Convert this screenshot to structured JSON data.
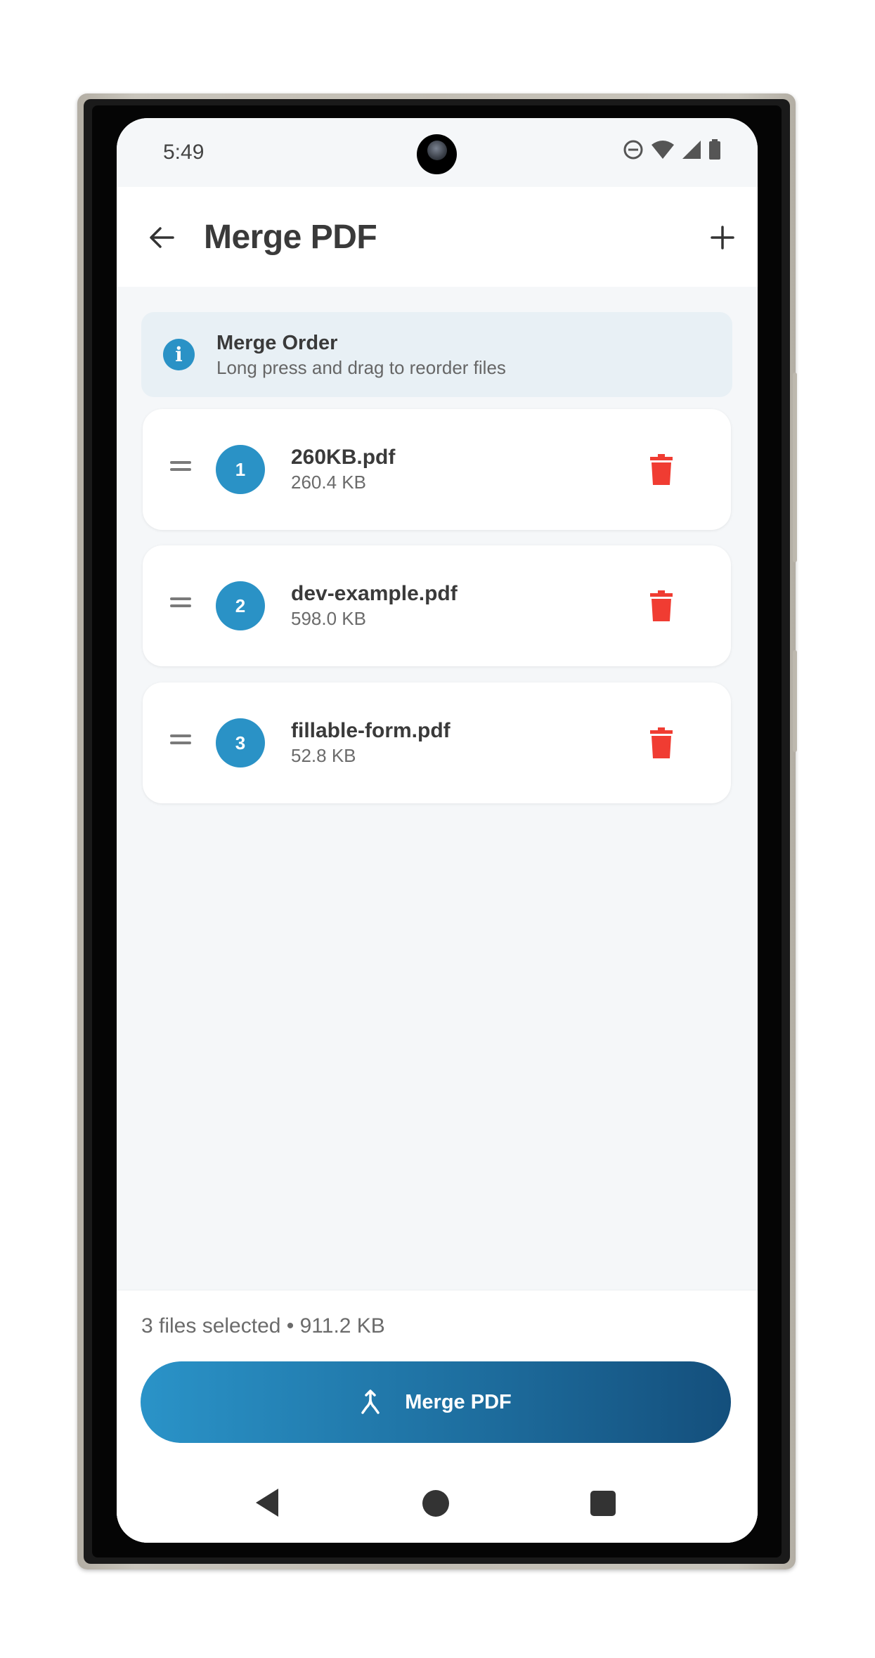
{
  "status_bar": {
    "time": "5:49",
    "icons": [
      "do-not-disturb-icon",
      "wifi-icon",
      "signal-icon",
      "battery-icon"
    ]
  },
  "app_bar": {
    "title": "Merge PDF",
    "back_icon": "arrow-left-icon",
    "add_icon": "plus-icon"
  },
  "info_banner": {
    "title": "Merge Order",
    "subtitle": "Long press and drag to reorder files",
    "icon_text": "i"
  },
  "files": [
    {
      "order": "1",
      "name": "260KB.pdf",
      "size": "260.4 KB"
    },
    {
      "order": "2",
      "name": "dev-example.pdf",
      "size": "598.0 KB"
    },
    {
      "order": "3",
      "name": "fillable-form.pdf",
      "size": "52.8 KB"
    }
  ],
  "footer": {
    "summary": "3 files selected • 911.2 KB",
    "merge_button_label": "Merge PDF",
    "merge_icon": "merge-icon"
  },
  "colors": {
    "accent": "#2a92c6",
    "delete": "#f03c32",
    "button_gradient_start": "#2a93c8",
    "button_gradient_end": "#144f7c"
  }
}
